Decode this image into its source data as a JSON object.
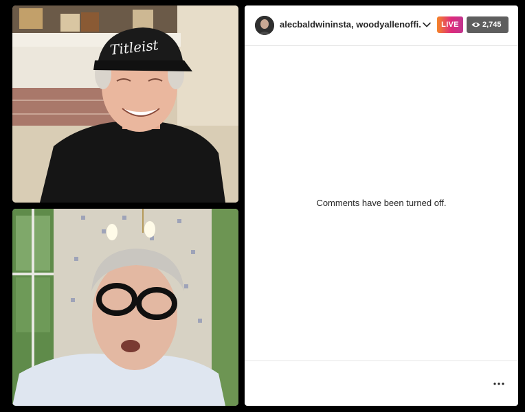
{
  "stream": {
    "participants_label": "alecbaldwininsta, woodyallenoffi...",
    "live_label": "LIVE",
    "viewer_count": "2,745"
  },
  "comments": {
    "status_text": "Comments have been turned off."
  },
  "colors": {
    "live_gradient_start": "#f58529",
    "live_gradient_end": "#c1358f",
    "viewer_badge_bg": "#5e5e5e",
    "panel_bg": "#ffffff"
  },
  "icons": {
    "dropdown": "chevron-down-icon",
    "viewers": "eye-icon",
    "more": "more-options-icon"
  },
  "cap_logo_text": "Titleist"
}
